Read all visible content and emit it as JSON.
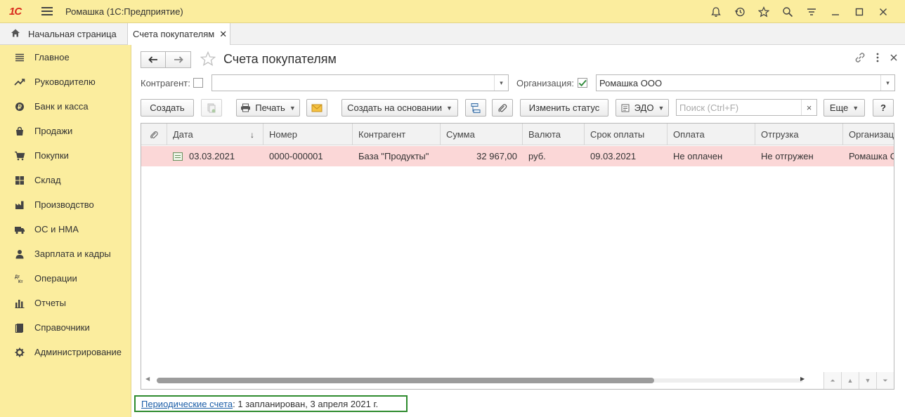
{
  "app": {
    "logo_text": "1С",
    "title": "Ромашка  (1С:Предприятие)",
    "toolbar_icons": [
      "bell-icon",
      "history-icon",
      "star-icon",
      "search-icon",
      "settings-icon",
      "minimize-icon",
      "maximize-icon",
      "close-icon"
    ]
  },
  "tabs": {
    "home_label": "Начальная страница",
    "active_label": "Счета покупателям",
    "close_glyph": "✕"
  },
  "sidebar": {
    "items": [
      {
        "label": "Главное",
        "icon": "menu-lines-icon"
      },
      {
        "label": "Руководителю",
        "icon": "trend-icon"
      },
      {
        "label": "Банк и касса",
        "icon": "coin-icon"
      },
      {
        "label": "Продажи",
        "icon": "bag-icon"
      },
      {
        "label": "Покупки",
        "icon": "cart-icon"
      },
      {
        "label": "Склад",
        "icon": "warehouse-icon"
      },
      {
        "label": "Производство",
        "icon": "factory-icon"
      },
      {
        "label": "ОС и НМА",
        "icon": "truck-icon"
      },
      {
        "label": "Зарплата и кадры",
        "icon": "person-icon"
      },
      {
        "label": "Операции",
        "icon": "dt-kt-icon"
      },
      {
        "label": "Отчеты",
        "icon": "bar-chart-icon"
      },
      {
        "label": "Справочники",
        "icon": "books-icon"
      },
      {
        "label": "Администрирование",
        "icon": "gear-icon"
      }
    ]
  },
  "form": {
    "title": "Счета покупателям",
    "filters": {
      "counterparty_label": "Контрагент:",
      "counterparty_value": "",
      "org_label": "Организация:",
      "org_value": "Ромашка ООО",
      "org_checked": true
    },
    "toolbar": {
      "create": "Создать",
      "print": "Печать",
      "create_based": "Создать на основании",
      "change_status": "Изменить статус",
      "edo": "ЭДО",
      "search_placeholder": "Поиск (Ctrl+F)",
      "more": "Еще",
      "help": "?"
    },
    "grid": {
      "columns": [
        "Дата",
        "Номер",
        "Контрагент",
        "Сумма",
        "Валюта",
        "Срок оплаты",
        "Оплата",
        "Отгрузка",
        "Организация"
      ],
      "rows": [
        {
          "date": "03.03.2021",
          "number": "0000-000001",
          "counterparty": "База \"Продукты\"",
          "sum": "32 967,00",
          "currency": "руб.",
          "due": "09.03.2021",
          "payment": "Не оплачен",
          "shipment": "Не отгружен",
          "org": "Ромашка ООО"
        }
      ]
    },
    "footer": {
      "link": "Периодические счета",
      "text": ": 1 запланирован, 3 апреля 2021 г."
    }
  }
}
